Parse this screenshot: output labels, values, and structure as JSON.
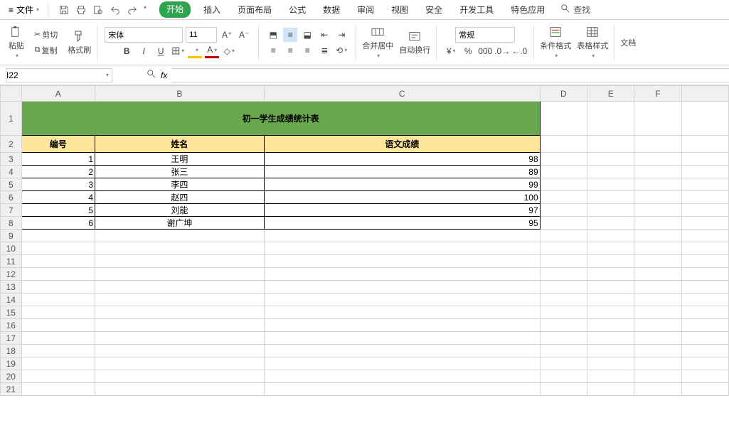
{
  "menubar": {
    "file": "文件",
    "tabs": [
      "开始",
      "插入",
      "页面布局",
      "公式",
      "数据",
      "审阅",
      "视图",
      "安全",
      "开发工具",
      "特色应用"
    ],
    "active_tab": "开始",
    "search": "查找"
  },
  "ribbon": {
    "paste": "粘贴",
    "cut": "剪切",
    "copy": "复制",
    "format_painter": "格式刷",
    "font_name": "宋体",
    "font_size": "11",
    "merge_center": "合并居中",
    "wrap_text": "自动换行",
    "number_format": "常规",
    "cond_format": "条件格式",
    "table_style": "表格样式",
    "text_trunc": "文档"
  },
  "namebox": "I22",
  "formula": "",
  "columns": [
    "A",
    "B",
    "C",
    "D",
    "E",
    "F"
  ],
  "sheet": {
    "title": "初一学生成绩统计表",
    "headers": [
      "编号",
      "姓名",
      "语文成绩"
    ],
    "rows": [
      {
        "id": "1",
        "name": "王明",
        "score": "98"
      },
      {
        "id": "2",
        "name": "张三",
        "score": "89"
      },
      {
        "id": "3",
        "name": "李四",
        "score": "99"
      },
      {
        "id": "4",
        "name": "赵四",
        "score": "100"
      },
      {
        "id": "5",
        "name": "刘能",
        "score": "97"
      },
      {
        "id": "6",
        "name": "谢广坤",
        "score": "95"
      }
    ]
  },
  "chart_data": {
    "type": "table",
    "title": "初一学生成绩统计表",
    "columns": [
      "编号",
      "姓名",
      "语文成绩"
    ],
    "rows": [
      [
        1,
        "王明",
        98
      ],
      [
        2,
        "张三",
        89
      ],
      [
        3,
        "李四",
        99
      ],
      [
        4,
        "赵四",
        100
      ],
      [
        5,
        "刘能",
        97
      ],
      [
        6,
        "谢广坤",
        95
      ]
    ]
  }
}
